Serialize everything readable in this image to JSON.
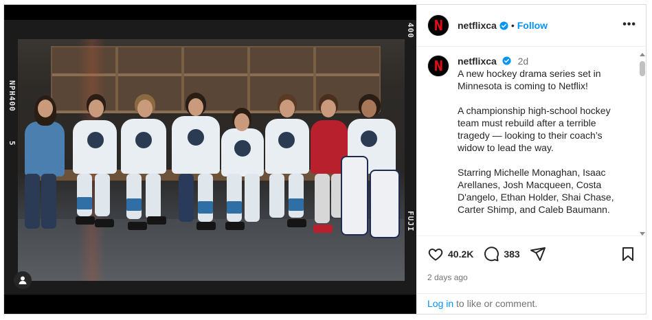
{
  "post": {
    "media": {
      "film_top_code": "400",
      "film_left_code": "NPH400",
      "film_left_frame": "5",
      "film_right_code": "FUJI NPH400",
      "tag_icon": "person-icon"
    },
    "header": {
      "username": "netflixca",
      "separator": "•",
      "follow_label": "Follow",
      "more_icon": "•••"
    },
    "caption": {
      "username": "netflixca",
      "time": "2d",
      "paragraphs": [
        "A new hockey drama series set in Minnesota is coming to Netflix!",
        "A championship high-school hockey team must rebuild after a terrible tragedy — looking to their coach’s widow to lead the way.",
        "Starring Michelle Monaghan, Isaac Arellanes, Josh Macqueen, Costa D'angelo, Ethan Holder, Shai Chase, Carter Shimp, and Caleb Baumann."
      ]
    },
    "actions": {
      "likes": "40.2K",
      "comments": "383",
      "posted": "2 days ago"
    },
    "login": {
      "link": "Log in",
      "rest": " to like or comment."
    }
  },
  "colors": {
    "accent": "#0095f6",
    "brand": "#e50914",
    "verified": "#0095f6",
    "muted": "#737373"
  }
}
